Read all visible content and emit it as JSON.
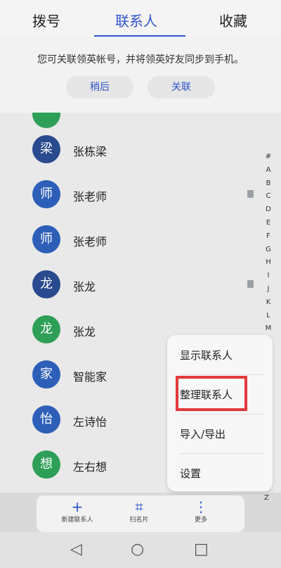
{
  "tabs": [
    {
      "label": "拨号"
    },
    {
      "label": "联系人"
    },
    {
      "label": "收藏"
    }
  ],
  "banner": {
    "message": "您可关联领英帐号，并将领英好友同步到手机。",
    "later_label": "稍后",
    "link_label": "关联"
  },
  "contacts": [
    {
      "avatar": "梁",
      "name": "张栋梁",
      "color": "#2a4a8f",
      "card": false
    },
    {
      "avatar": "师",
      "name": "张老师",
      "color": "#2d5fb8",
      "card": true
    },
    {
      "avatar": "师",
      "name": "张老师",
      "color": "#2d5fb8",
      "card": false
    },
    {
      "avatar": "龙",
      "name": "张龙",
      "color": "#2a4a8f",
      "card": true
    },
    {
      "avatar": "龙",
      "name": "张龙",
      "color": "#2e9f57",
      "card": false
    },
    {
      "avatar": "家",
      "name": "智能家",
      "color": "#2d5fb8",
      "card": false
    },
    {
      "avatar": "怡",
      "name": "左诗怡",
      "color": "#2d5fb8",
      "card": false
    },
    {
      "avatar": "想",
      "name": "左右想",
      "color": "#2e9f57",
      "card": false
    }
  ],
  "index": [
    "#",
    "A",
    "B",
    "C",
    "D",
    "E",
    "F",
    "G",
    "H",
    "I",
    "J",
    "K",
    "L",
    "M"
  ],
  "index_last": "Z",
  "menu": {
    "items": [
      "显示联系人",
      "整理联系人",
      "导入/导出",
      "设置"
    ]
  },
  "toolbar": {
    "add_label": "新建联系人",
    "scan_label": "扫名片",
    "more_label": "更多",
    "add_icon": "+",
    "scan_icon": "⌗",
    "more_icon": "⋮"
  },
  "navbar": {
    "back_icon": "◁",
    "home_icon": "○",
    "recent_icon": "□"
  }
}
